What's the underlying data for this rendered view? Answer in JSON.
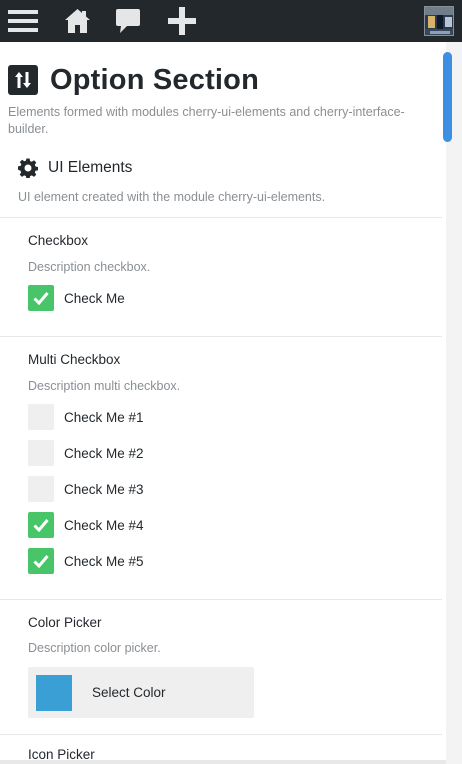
{
  "topbar": {
    "icons": [
      "menu-icon",
      "home-icon",
      "comment-icon",
      "plus-icon"
    ],
    "background": "#23282d",
    "icon_color": "#e4e6e8"
  },
  "page": {
    "title": "Option Section",
    "description": "Elements formed with modules cherry-ui-elements and cherry-interface-builder."
  },
  "section": {
    "title": "UI Elements",
    "description": "UI element created with the module cherry-ui-elements."
  },
  "options": {
    "checkbox": {
      "title": "Checkbox",
      "description": "Description checkbox.",
      "item": {
        "label": "Check Me",
        "checked": true
      }
    },
    "multi_checkbox": {
      "title": "Multi Checkbox",
      "description": "Description multi checkbox.",
      "items": [
        {
          "label": "Check Me #1",
          "checked": false
        },
        {
          "label": "Check Me #2",
          "checked": false
        },
        {
          "label": "Check Me #3",
          "checked": false
        },
        {
          "label": "Check Me #4",
          "checked": true
        },
        {
          "label": "Check Me #5",
          "checked": true
        }
      ]
    },
    "color_picker": {
      "title": "Color Picker",
      "description": "Description color picker.",
      "button_label": "Select Color",
      "value": "#3a9fd5"
    },
    "next": {
      "title": "Icon Picker"
    }
  },
  "colors": {
    "accent": "#48c569",
    "scrollbar": "#3d8fe3"
  }
}
